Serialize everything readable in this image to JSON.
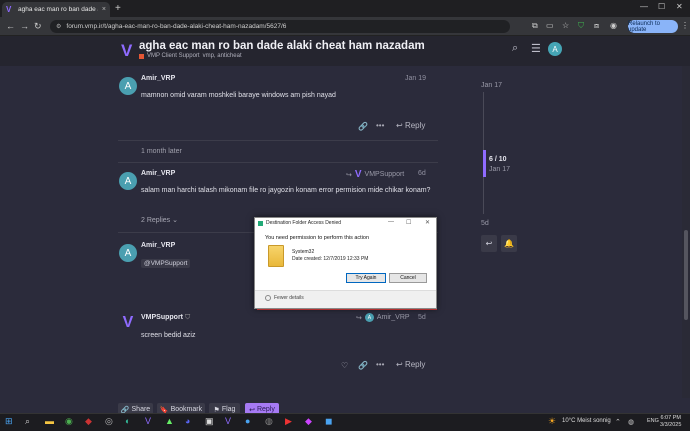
{
  "browser": {
    "tab_title": "agha eac man ro ban dade alaki",
    "tab_close": "×",
    "new_tab": "+",
    "url": "forum.vmp.ir/t/agha-eac-man-ro-ban-dade-alaki-cheat-ham-nazadam/5627/6",
    "relaunch_label": "Relaunch to update"
  },
  "header": {
    "title": "agha eac man ro ban dade alaki cheat ham nazadam",
    "category": "VMP Client Support",
    "tags": "vmp, anticheat",
    "avatar_letter": "A"
  },
  "posts": [
    {
      "avatar": "A",
      "user": "Amir_VRP",
      "date": "Jan 19",
      "text": "mamnon omid varam moshkeli baraye windows am pish nayad",
      "reply_label": "Reply"
    },
    {
      "avatar": "A",
      "user": "Amir_VRP",
      "date": "6d",
      "reply_to": "VMPSupport",
      "text": "salam man harchi talash mikonam file ro jaygozin konam error permision mide chikar konam?",
      "replies_label": "2 Replies"
    },
    {
      "avatar": "A",
      "user": "Amir_VRP",
      "mention": "@VMPSupport"
    },
    {
      "avatar": "V",
      "user": "VMPSupport",
      "date": "5d",
      "reply_to": "Amir_VRP",
      "text": "screen bedid aziz",
      "reply_label": "Reply"
    }
  ],
  "gap_label": "1 month later",
  "timeline": {
    "top_date": "Jan 17",
    "count": "6 / 10",
    "count_date": "Jan 17",
    "bottom_date": "5d"
  },
  "dialog": {
    "title": "Destination Folder Access Denied",
    "message": "You need permission to perform this action",
    "folder_name": "System32",
    "folder_date": "Date created: 12/7/2019 12:33 PM",
    "try_again": "Try Again",
    "cancel": "Cancel",
    "fewer_details": "Fewer details"
  },
  "bottom_bar": {
    "share": "Share",
    "bookmark": "Bookmark",
    "flag": "Flag",
    "reply": "Reply"
  },
  "taskbar": {
    "weather": "10°C  Meist sonnig",
    "lang": "ENG",
    "time": "6:07 PM",
    "date": "3/3/2025"
  }
}
